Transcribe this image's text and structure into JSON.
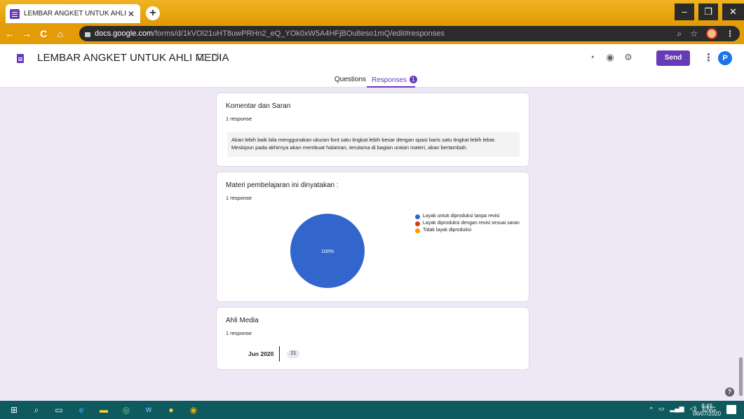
{
  "browser": {
    "tab_title": "LEMBAR ANGKET UNTUK AHLI M",
    "new_tab": "+",
    "url_host": "docs.google.com",
    "url_path": "/forms/d/1kVOl21uHT8uwPRHn2_eQ_YOk0xW5A4HFjBOu8eso1mQ/edit#responses",
    "window_controls": [
      "–",
      "❐",
      "✕"
    ]
  },
  "form": {
    "title": "LEMBAR ANGKET UNTUK AHLI MEDIA",
    "send_label": "Send",
    "avatar_initial": "P",
    "tabs": [
      {
        "label": "Questions"
      },
      {
        "label": "Responses",
        "badge": "1"
      }
    ]
  },
  "cards": [
    {
      "title": "Komentar dan Saran",
      "subtitle": "1 response",
      "answer": "Akan lebih baik bila menggunakan ukuran font satu tingkat lebih besar dengan spasi baris satu tingkat lebih lebar. Meskipun pada akhirnya akan membuat halaman, terutama di bagian uraian materi, akan bertambah."
    },
    {
      "title": "Materi pembelajaran ini dinyatakan :",
      "subtitle": "1 response"
    },
    {
      "title": "Ahli Media",
      "subtitle": "1 response",
      "date_label": "Jun 2020",
      "date_value": "21"
    }
  ],
  "chart_data": {
    "type": "pie",
    "categories": [
      "Layak untuk diproduksi tanpa revisi",
      "Layak diproduksi dengan revisi sesuai saran",
      "Tidak layak diproduksi"
    ],
    "values": [
      100,
      0,
      0
    ],
    "colors": [
      "#3366cc",
      "#dc3912",
      "#ff9900"
    ],
    "slice_label": "100%",
    "legend_position": "right"
  },
  "taskbar": {
    "language": "ENG",
    "time": "8:49",
    "date": "06/07/2020"
  }
}
